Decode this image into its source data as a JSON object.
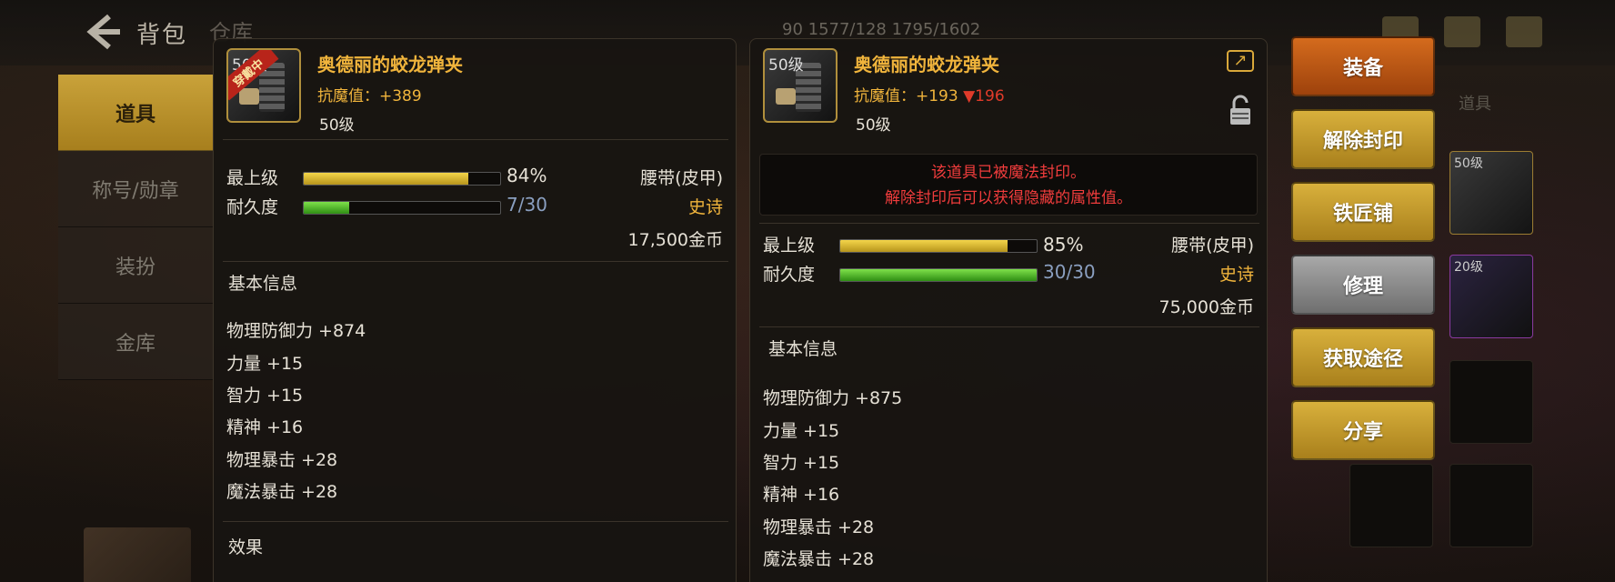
{
  "topbar": {
    "title": "背包",
    "second_tab": "仓库",
    "stats": "90   1577/128   1795/1602"
  },
  "left_menu": {
    "items": [
      {
        "label": "道具",
        "active": true
      },
      {
        "label": "称号/勋章",
        "active": false
      },
      {
        "label": "装扮",
        "active": false
      },
      {
        "label": "金库",
        "active": false
      }
    ]
  },
  "right_tabs": [
    "",
    "道具"
  ],
  "grid_badges": [
    "50级",
    "20级"
  ],
  "equipped_item": {
    "level_badge": "50级",
    "equipped_tag": "穿戴中",
    "name": "奥德丽的蛟龙弹夹",
    "magic_resist": "抗魔值：+389",
    "level": "50级",
    "max_level_label": "最上级",
    "max_level_pct": "84%",
    "max_level_value": 0.84,
    "durability_label": "耐久度",
    "durability": "7/30",
    "durability_value": 0.233,
    "type": "腰带(皮甲)",
    "rarity": "史诗",
    "price": "17,500金币",
    "basic_info_title": "基本信息",
    "attributes": [
      "物理防御力 +874",
      "力量 +15",
      "智力 +15",
      "精神 +16",
      "物理暴击 +28",
      "魔法暴击 +28"
    ],
    "effect_title": "效果"
  },
  "compare_item": {
    "level_badge": "50级",
    "name": "奥德丽的蛟龙弹夹",
    "magic_resist": "抗魔值：+193",
    "magic_resist_diff": "▼196",
    "level": "50级",
    "sealed_line1": "该道具已被魔法封印。",
    "sealed_line2": "解除封印后可以获得隐藏的属性值。",
    "max_level_label": "最上级",
    "max_level_pct": "85%",
    "max_level_value": 0.85,
    "durability_label": "耐久度",
    "durability": "30/30",
    "durability_value": 1.0,
    "type": "腰带(皮甲)",
    "rarity": "史诗",
    "price": "75,000金币",
    "basic_info_title": "基本信息",
    "attributes": [
      "物理防御力 +875",
      "力量 +15",
      "智力 +15",
      "精神 +16",
      "物理暴击 +28",
      "魔法暴击 +28"
    ]
  },
  "actions": {
    "equip": "装备",
    "unseal": "解除封印",
    "blacksmith": "铁匠铺",
    "repair": "修理",
    "obtain": "获取途径",
    "share": "分享"
  },
  "colors": {
    "gold_text": "#f0b43c",
    "red_text": "#e03b2a",
    "button_gold": "#d8b03c",
    "button_orange": "#d46b1d"
  }
}
